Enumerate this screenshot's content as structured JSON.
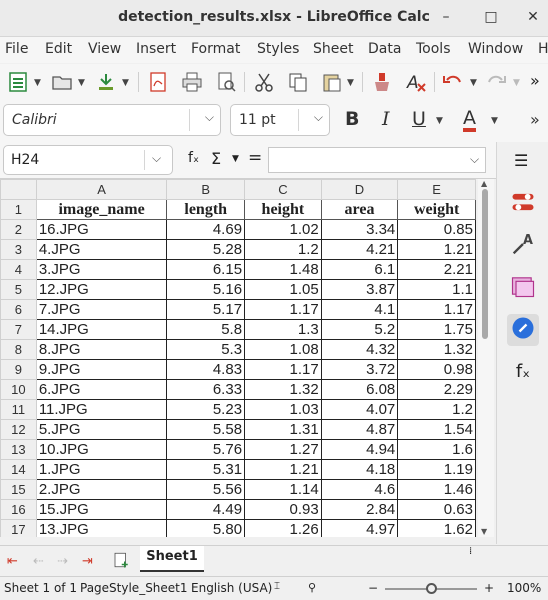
{
  "window": {
    "title": "detection_results.xlsx - LibreOffice Calc",
    "minimize": "–",
    "maximize": "□",
    "close": "✕"
  },
  "menu": [
    "File",
    "Edit",
    "View",
    "Insert",
    "Format",
    "Styles",
    "Sheet",
    "Data",
    "Tools",
    "Window",
    "H"
  ],
  "font": {
    "name": "Calibri",
    "size": "11 pt"
  },
  "format_buttons": {
    "bold": "B",
    "italic": "I",
    "underline": "U",
    "font_color": "A",
    "more": "»"
  },
  "namebox": {
    "value": "H24"
  },
  "formula": {
    "fx": "fₓ",
    "sum": "Σ",
    "equals": "=",
    "value": ""
  },
  "sheet": {
    "columns": [
      "A",
      "B",
      "C",
      "D",
      "E"
    ],
    "header_row": [
      "image_name",
      "length",
      "height",
      "area",
      "weight"
    ],
    "rows": [
      [
        "16.JPG",
        "4.69",
        "1.02",
        "3.34",
        "0.85"
      ],
      [
        "4.JPG",
        "5.28",
        "1.2",
        "4.21",
        "1.21"
      ],
      [
        "3.JPG",
        "6.15",
        "1.48",
        "6.1",
        "2.21"
      ],
      [
        "12.JPG",
        "5.16",
        "1.05",
        "3.87",
        "1.1"
      ],
      [
        "7.JPG",
        "5.17",
        "1.17",
        "4.1",
        "1.17"
      ],
      [
        "14.JPG",
        "5.8",
        "1.3",
        "5.2",
        "1.75"
      ],
      [
        "8.JPG",
        "5.3",
        "1.08",
        "4.32",
        "1.32"
      ],
      [
        "9.JPG",
        "4.83",
        "1.17",
        "3.72",
        "0.98"
      ],
      [
        "6.JPG",
        "6.33",
        "1.32",
        "6.08",
        "2.29"
      ],
      [
        "11.JPG",
        "5.23",
        "1.03",
        "4.07",
        "1.2"
      ],
      [
        "5.JPG",
        "5.58",
        "1.31",
        "4.87",
        "1.54"
      ],
      [
        "10.JPG",
        "5.76",
        "1.27",
        "4.94",
        "1.6"
      ],
      [
        "1.JPG",
        "5.31",
        "1.21",
        "4.18",
        "1.19"
      ],
      [
        "2.JPG",
        "5.56",
        "1.14",
        "4.6",
        "1.46"
      ],
      [
        "15.JPG",
        "4.49",
        "0.93",
        "2.84",
        "0.63"
      ],
      [
        "13.JPG",
        "5.80",
        "1.26",
        "4.97",
        "1.62"
      ]
    ],
    "row_numbers": [
      "1",
      "2",
      "3",
      "4",
      "5",
      "6",
      "7",
      "8",
      "9",
      "10",
      "11",
      "12",
      "13",
      "14",
      "15",
      "16",
      "17"
    ]
  },
  "tabs": {
    "active": "Sheet1"
  },
  "status": {
    "sheet": "Sheet 1 of 1",
    "page_style": "PageStyle_Sheet1",
    "language": "English (USA)",
    "zoom": "100%",
    "zoom_minus": "−",
    "zoom_plus": "+"
  },
  "colors": {
    "accent": "#2a6fdb",
    "red": "#d03a2a",
    "green": "#2b8a3e"
  }
}
